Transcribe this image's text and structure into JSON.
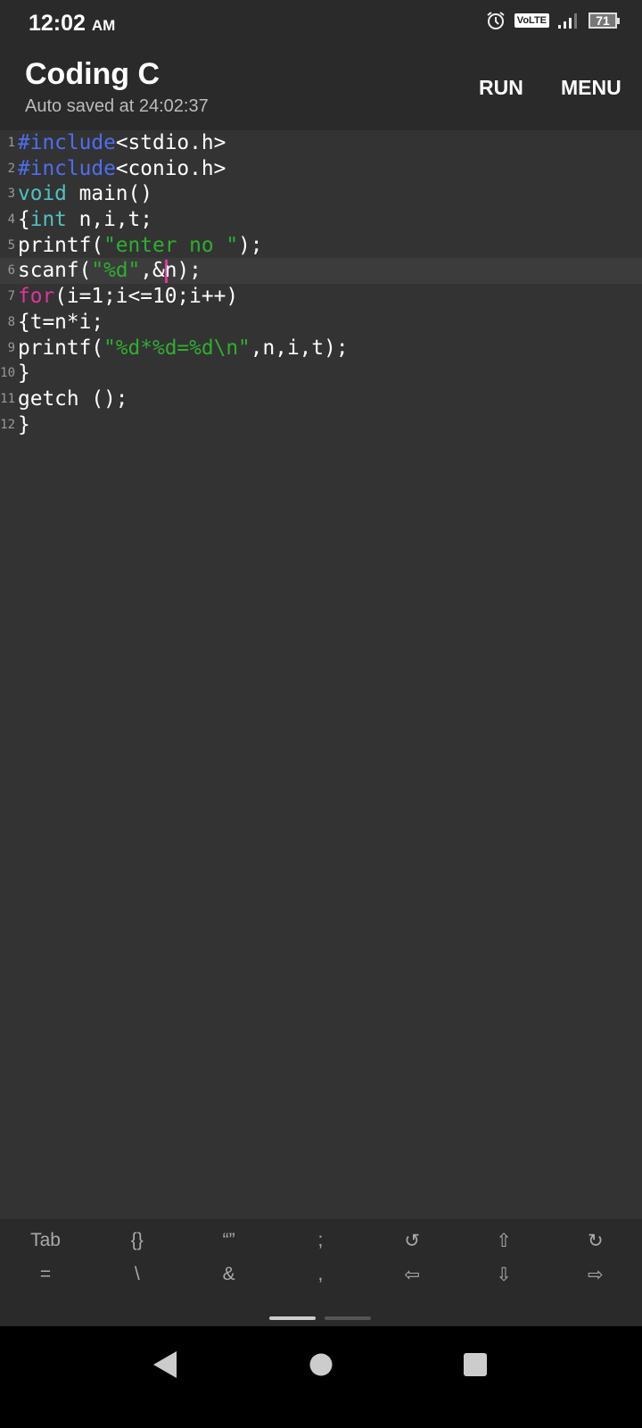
{
  "status": {
    "time": "12:02",
    "ampm": "AM",
    "volte": "VoLTE",
    "battery": "71"
  },
  "header": {
    "title": "Coding C",
    "subtitle": "Auto saved at 24:02:37",
    "run": "RUN",
    "menu": "MENU"
  },
  "editor": {
    "current_line": 6,
    "caret_line": 6,
    "caret_after": "scanf(\"%d\",&",
    "lines": [
      [
        {
          "t": "#include",
          "c": "pre"
        },
        {
          "t": "<stdio.h>",
          "c": "txt"
        }
      ],
      [
        {
          "t": "#include",
          "c": "pre"
        },
        {
          "t": "<conio.h>",
          "c": "txt"
        }
      ],
      [
        {
          "t": "void",
          "c": "kw"
        },
        {
          "t": " main()",
          "c": "txt"
        }
      ],
      [
        {
          "t": "{",
          "c": "txt"
        },
        {
          "t": "int",
          "c": "kw"
        },
        {
          "t": " n,i,t;",
          "c": "txt"
        }
      ],
      [
        {
          "t": "printf(",
          "c": "txt"
        },
        {
          "t": "\"enter no \"",
          "c": "str"
        },
        {
          "t": ");",
          "c": "txt"
        }
      ],
      [
        {
          "t": "scanf(",
          "c": "txt"
        },
        {
          "t": "\"%d\"",
          "c": "str"
        },
        {
          "t": ",&",
          "c": "txt"
        },
        {
          "t": "|",
          "c": "caret"
        },
        {
          "t": "n);",
          "c": "txt"
        }
      ],
      [
        {
          "t": "for",
          "c": "ctl"
        },
        {
          "t": "(i=1;i<=10;i++)",
          "c": "txt"
        }
      ],
      [
        {
          "t": "{t=n*i;",
          "c": "txt"
        }
      ],
      [
        {
          "t": "printf(",
          "c": "txt"
        },
        {
          "t": "\"%d*%d=%d\\n\"",
          "c": "str"
        },
        {
          "t": ",n,i,t);",
          "c": "txt"
        }
      ],
      [
        {
          "t": "}",
          "c": "txt"
        }
      ],
      [
        {
          "t": "getch ();",
          "c": "txt"
        }
      ],
      [
        {
          "t": "}",
          "c": "txt"
        }
      ]
    ]
  },
  "keys": {
    "row1": [
      "Tab",
      "{}",
      "“”",
      ";",
      "↺",
      "⇧",
      "↻"
    ],
    "row2": [
      "=",
      "\\",
      "&",
      ",",
      "⇦",
      "⇩",
      "⇨"
    ]
  },
  "keynames": {
    "row1": [
      "tab",
      "braces",
      "quotes",
      "semicolon",
      "undo",
      "shift-up",
      "redo"
    ],
    "row2": [
      "equals",
      "backslash",
      "ampersand",
      "comma",
      "arrow-left",
      "arrow-down",
      "arrow-right"
    ]
  }
}
